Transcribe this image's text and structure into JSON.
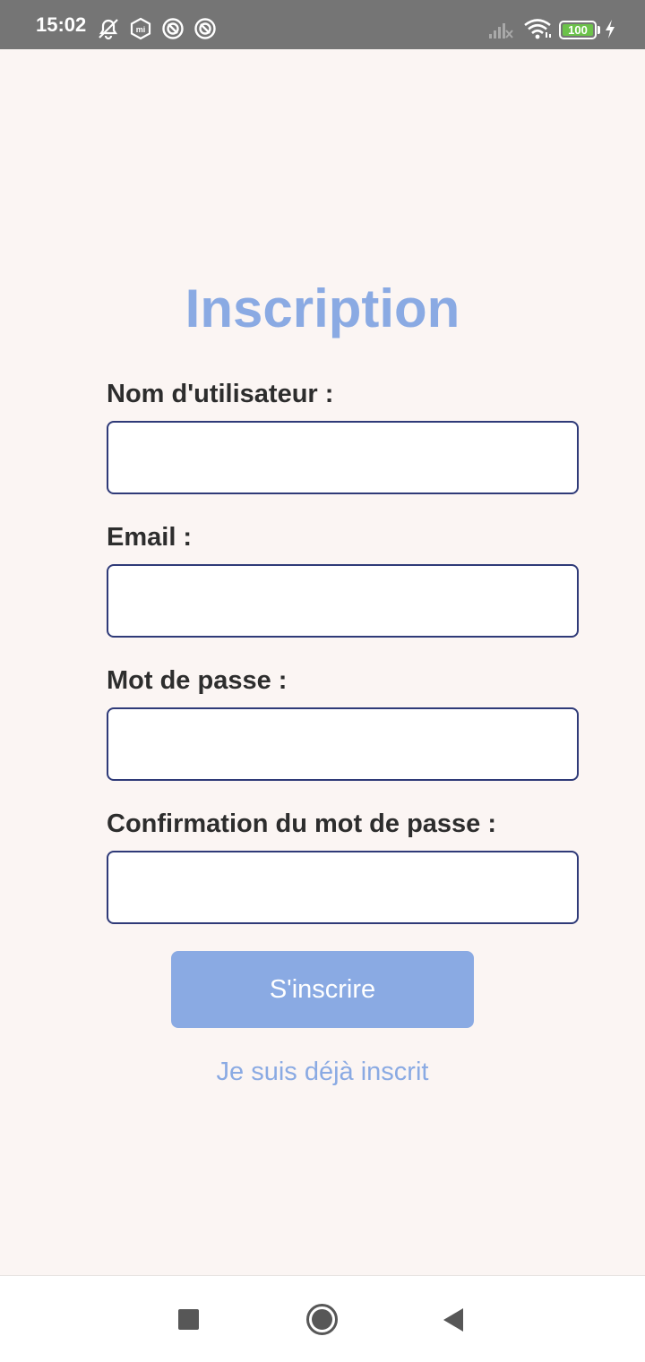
{
  "status_bar": {
    "time": "15:02",
    "icons_left": [
      "alarm-off-icon",
      "mi-icon",
      "notification-icon",
      "notification-icon"
    ],
    "icons_right": [
      "signal-icon",
      "wifi-icon",
      "battery-icon",
      "charging-icon"
    ],
    "battery": "100"
  },
  "form": {
    "title": "Inscription",
    "fields": [
      {
        "label": "Nom d'utilisateur :",
        "value": ""
      },
      {
        "label": "Email :",
        "value": ""
      },
      {
        "label": "Mot de passe :",
        "value": ""
      },
      {
        "label": "Confirmation du mot de passe :",
        "value": ""
      }
    ],
    "submit_label": "S'inscrire",
    "login_link": "Je suis déjà inscrit"
  },
  "nav_bar": {
    "buttons": [
      "recents-button",
      "home-button",
      "back-button"
    ]
  },
  "colors": {
    "accent": "#8aaae3",
    "background": "#fbf5f3",
    "input_border": "#2f3a78",
    "status_bar": "#757575",
    "label_text": "#2d2d2d"
  }
}
